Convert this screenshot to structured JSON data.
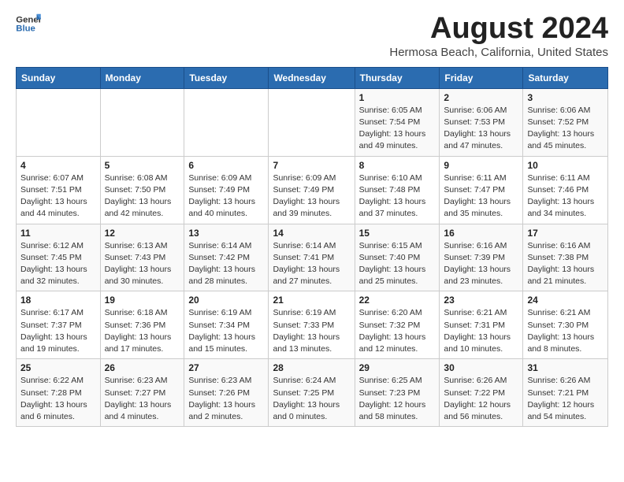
{
  "logo": {
    "general": "General",
    "blue": "Blue"
  },
  "title": "August 2024",
  "subtitle": "Hermosa Beach, California, United States",
  "weekdays": [
    "Sunday",
    "Monday",
    "Tuesday",
    "Wednesday",
    "Thursday",
    "Friday",
    "Saturday"
  ],
  "weeks": [
    [
      {
        "day": "",
        "info": ""
      },
      {
        "day": "",
        "info": ""
      },
      {
        "day": "",
        "info": ""
      },
      {
        "day": "",
        "info": ""
      },
      {
        "day": "1",
        "info": "Sunrise: 6:05 AM\nSunset: 7:54 PM\nDaylight: 13 hours\nand 49 minutes."
      },
      {
        "day": "2",
        "info": "Sunrise: 6:06 AM\nSunset: 7:53 PM\nDaylight: 13 hours\nand 47 minutes."
      },
      {
        "day": "3",
        "info": "Sunrise: 6:06 AM\nSunset: 7:52 PM\nDaylight: 13 hours\nand 45 minutes."
      }
    ],
    [
      {
        "day": "4",
        "info": "Sunrise: 6:07 AM\nSunset: 7:51 PM\nDaylight: 13 hours\nand 44 minutes."
      },
      {
        "day": "5",
        "info": "Sunrise: 6:08 AM\nSunset: 7:50 PM\nDaylight: 13 hours\nand 42 minutes."
      },
      {
        "day": "6",
        "info": "Sunrise: 6:09 AM\nSunset: 7:49 PM\nDaylight: 13 hours\nand 40 minutes."
      },
      {
        "day": "7",
        "info": "Sunrise: 6:09 AM\nSunset: 7:49 PM\nDaylight: 13 hours\nand 39 minutes."
      },
      {
        "day": "8",
        "info": "Sunrise: 6:10 AM\nSunset: 7:48 PM\nDaylight: 13 hours\nand 37 minutes."
      },
      {
        "day": "9",
        "info": "Sunrise: 6:11 AM\nSunset: 7:47 PM\nDaylight: 13 hours\nand 35 minutes."
      },
      {
        "day": "10",
        "info": "Sunrise: 6:11 AM\nSunset: 7:46 PM\nDaylight: 13 hours\nand 34 minutes."
      }
    ],
    [
      {
        "day": "11",
        "info": "Sunrise: 6:12 AM\nSunset: 7:45 PM\nDaylight: 13 hours\nand 32 minutes."
      },
      {
        "day": "12",
        "info": "Sunrise: 6:13 AM\nSunset: 7:43 PM\nDaylight: 13 hours\nand 30 minutes."
      },
      {
        "day": "13",
        "info": "Sunrise: 6:14 AM\nSunset: 7:42 PM\nDaylight: 13 hours\nand 28 minutes."
      },
      {
        "day": "14",
        "info": "Sunrise: 6:14 AM\nSunset: 7:41 PM\nDaylight: 13 hours\nand 27 minutes."
      },
      {
        "day": "15",
        "info": "Sunrise: 6:15 AM\nSunset: 7:40 PM\nDaylight: 13 hours\nand 25 minutes."
      },
      {
        "day": "16",
        "info": "Sunrise: 6:16 AM\nSunset: 7:39 PM\nDaylight: 13 hours\nand 23 minutes."
      },
      {
        "day": "17",
        "info": "Sunrise: 6:16 AM\nSunset: 7:38 PM\nDaylight: 13 hours\nand 21 minutes."
      }
    ],
    [
      {
        "day": "18",
        "info": "Sunrise: 6:17 AM\nSunset: 7:37 PM\nDaylight: 13 hours\nand 19 minutes."
      },
      {
        "day": "19",
        "info": "Sunrise: 6:18 AM\nSunset: 7:36 PM\nDaylight: 13 hours\nand 17 minutes."
      },
      {
        "day": "20",
        "info": "Sunrise: 6:19 AM\nSunset: 7:34 PM\nDaylight: 13 hours\nand 15 minutes."
      },
      {
        "day": "21",
        "info": "Sunrise: 6:19 AM\nSunset: 7:33 PM\nDaylight: 13 hours\nand 13 minutes."
      },
      {
        "day": "22",
        "info": "Sunrise: 6:20 AM\nSunset: 7:32 PM\nDaylight: 13 hours\nand 12 minutes."
      },
      {
        "day": "23",
        "info": "Sunrise: 6:21 AM\nSunset: 7:31 PM\nDaylight: 13 hours\nand 10 minutes."
      },
      {
        "day": "24",
        "info": "Sunrise: 6:21 AM\nSunset: 7:30 PM\nDaylight: 13 hours\nand 8 minutes."
      }
    ],
    [
      {
        "day": "25",
        "info": "Sunrise: 6:22 AM\nSunset: 7:28 PM\nDaylight: 13 hours\nand 6 minutes."
      },
      {
        "day": "26",
        "info": "Sunrise: 6:23 AM\nSunset: 7:27 PM\nDaylight: 13 hours\nand 4 minutes."
      },
      {
        "day": "27",
        "info": "Sunrise: 6:23 AM\nSunset: 7:26 PM\nDaylight: 13 hours\nand 2 minutes."
      },
      {
        "day": "28",
        "info": "Sunrise: 6:24 AM\nSunset: 7:25 PM\nDaylight: 13 hours\nand 0 minutes."
      },
      {
        "day": "29",
        "info": "Sunrise: 6:25 AM\nSunset: 7:23 PM\nDaylight: 12 hours\nand 58 minutes."
      },
      {
        "day": "30",
        "info": "Sunrise: 6:26 AM\nSunset: 7:22 PM\nDaylight: 12 hours\nand 56 minutes."
      },
      {
        "day": "31",
        "info": "Sunrise: 6:26 AM\nSunset: 7:21 PM\nDaylight: 12 hours\nand 54 minutes."
      }
    ]
  ]
}
